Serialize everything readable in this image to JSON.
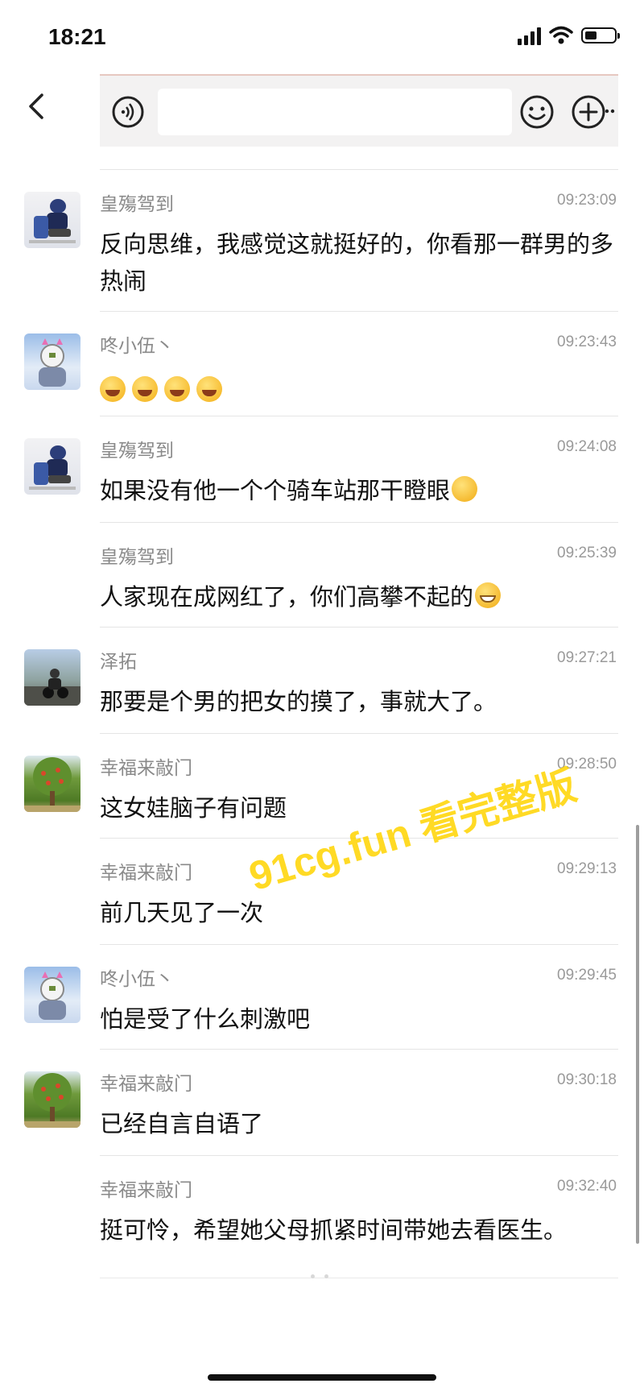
{
  "status_bar": {
    "time": "18:21"
  },
  "messages": [
    {
      "sender": "皇殤驾到",
      "time": "09:23:09",
      "text": "反向思维，我感觉这就挺好的，你看那一群男的多热闹"
    },
    {
      "sender": "咚小伍丶",
      "time": "09:23:43",
      "text": ""
    },
    {
      "sender": "皇殤驾到",
      "time": "09:24:08",
      "text": "如果没有他一个个骑车站那干瞪眼"
    },
    {
      "sender": "皇殤驾到",
      "time": "09:25:39",
      "text": "人家现在成网红了，你们高攀不起的"
    },
    {
      "sender": "泽拓",
      "time": "09:27:21",
      "text": "那要是个男的把女的摸了，事就大了。"
    },
    {
      "sender": "幸福来敲门",
      "time": "09:28:50",
      "text": "这女娃脑子有问题"
    },
    {
      "sender": "幸福来敲门",
      "time": "09:29:13",
      "text": "前几天见了一次"
    },
    {
      "sender": "咚小伍丶",
      "time": "09:29:45",
      "text": "怕是受了什么刺激吧"
    },
    {
      "sender": "幸福来敲门",
      "time": "09:30:18",
      "text": "已经自言自语了"
    },
    {
      "sender": "幸福来敲门",
      "time": "09:32:40",
      "text": "挺可怜，希望她父母抓紧时间带她去看医生。"
    }
  ],
  "watermark": "91cg.fun 看完整版"
}
